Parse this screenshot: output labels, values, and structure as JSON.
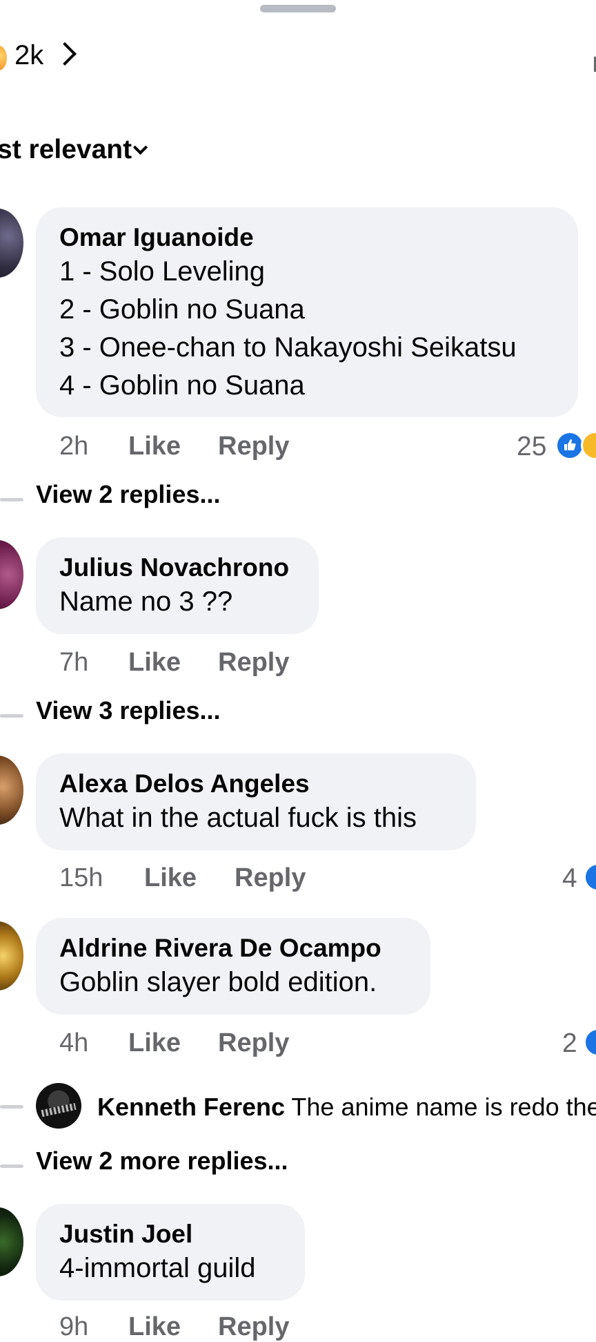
{
  "header": {
    "reaction_count": "2k",
    "sort_label": "st relevant"
  },
  "comments": [
    {
      "author": "Omar Iguanoide",
      "lines": [
        "1 - Solo Leveling",
        "2 - Goblin no Suana",
        "3 - Onee-chan to Nakayoshi Seikatsu",
        "4 - Goblin no Suana"
      ],
      "time": "2h",
      "like": "Like",
      "reply": "Reply",
      "reactions": "25",
      "view_replies": "View 2 replies..."
    },
    {
      "author": "Julius Novachrono",
      "lines": [
        "Name no 3  ??"
      ],
      "time": "7h",
      "like": "Like",
      "reply": "Reply",
      "view_replies": "View 3 replies..."
    },
    {
      "author": "Alexa Delos Angeles",
      "lines": [
        "What in the actual fuck is this"
      ],
      "time": "15h",
      "like": "Like",
      "reply": "Reply",
      "reactions": "4"
    },
    {
      "author": "Aldrine Rivera De Ocampo",
      "lines": [
        "Goblin slayer bold edition."
      ],
      "time": "4h",
      "like": "Like",
      "reply": "Reply",
      "reactions": "2",
      "inline_reply": {
        "author": "Kenneth Ferenc",
        "text": "The anime name is redo the"
      },
      "view_replies": "View 2 more replies..."
    },
    {
      "author": "Justin Joel",
      "lines": [
        "4-immortal guild"
      ],
      "time": "9h",
      "like": "Like",
      "reply": "Reply"
    }
  ]
}
